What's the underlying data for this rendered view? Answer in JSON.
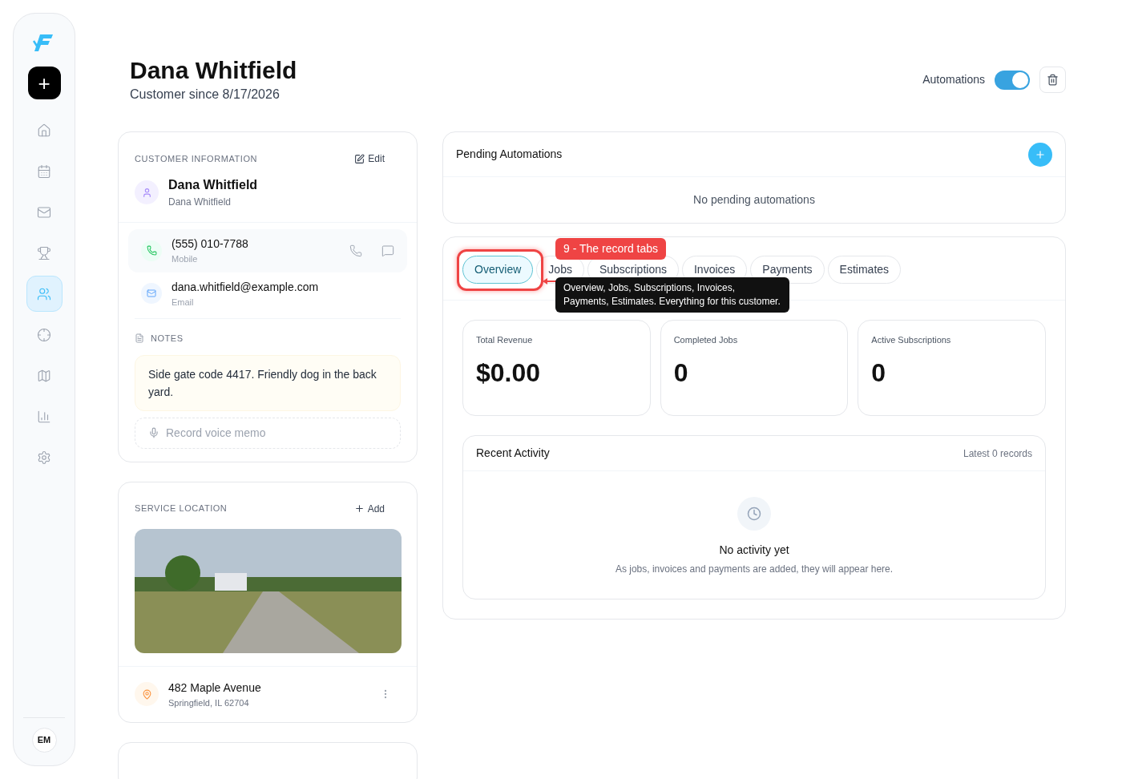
{
  "nav": {
    "new_label": "+",
    "items": [
      {
        "kind": "home",
        "selected": false
      },
      {
        "kind": "calendar",
        "selected": false
      },
      {
        "kind": "mail",
        "selected": false
      },
      {
        "kind": "trophy",
        "selected": false
      },
      {
        "kind": "users",
        "selected": true
      },
      {
        "kind": "crosshair",
        "selected": false
      },
      {
        "kind": "map",
        "selected": false
      },
      {
        "kind": "chart",
        "selected": false
      },
      {
        "kind": "settings",
        "selected": false
      }
    ],
    "avatar": "EM"
  },
  "header": {
    "title": "Dana Whitfield",
    "subtitle": "Customer since 8/17/2026",
    "automations_label": "Automations",
    "automations_on": true
  },
  "customer_info": {
    "heading": "CUSTOMER INFORMATION",
    "edit_label": "Edit",
    "name": "Dana Whitfield",
    "subname": "Dana Whitfield",
    "phone": "(555) 010-7788",
    "phone_label": "Mobile",
    "email": "dana.whitfield@example.com",
    "email_label": "Email",
    "notes_heading": "NOTES",
    "note": "Side gate code 4417. Friendly dog in the back yard.",
    "voice_memo": "Record voice memo"
  },
  "service_location": {
    "heading": "SERVICE LOCATION",
    "add_label": "Add",
    "address": "482 Maple Avenue",
    "city": "Springfield, IL 62704"
  },
  "pending_automations": {
    "title": "Pending Automations",
    "empty": "No pending automations"
  },
  "tabs": [
    {
      "label": "Overview",
      "selected": true
    },
    {
      "label": "Jobs",
      "selected": false
    },
    {
      "label": "Subscriptions",
      "selected": false
    },
    {
      "label": "Invoices",
      "selected": false
    },
    {
      "label": "Payments",
      "selected": false
    },
    {
      "label": "Estimates",
      "selected": false
    }
  ],
  "annotation": {
    "label": "9 - The record tabs",
    "tooltip": "Overview, Jobs, Subscriptions, Invoices, Payments, Estimates. Everything for this customer."
  },
  "stats": [
    {
      "label": "Total Revenue",
      "value": "$0.00"
    },
    {
      "label": "Completed Jobs",
      "value": "0"
    },
    {
      "label": "Active Subscriptions",
      "value": "0"
    }
  ],
  "recent_activity": {
    "title": "Recent Activity",
    "meta": "Latest 0 records",
    "empty_title": "No activity yet",
    "empty_text": "As jobs, invoices and payments are added, they will appear here."
  }
}
